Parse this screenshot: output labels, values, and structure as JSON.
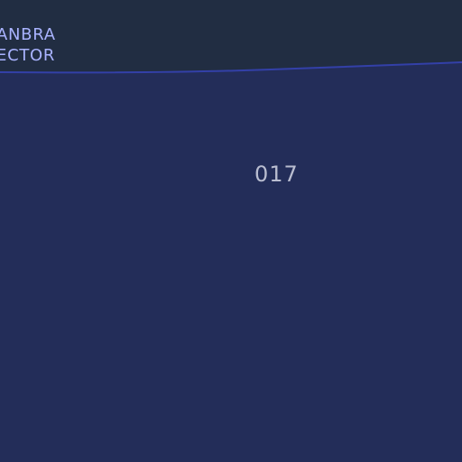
{
  "map": {
    "colors": {
      "background": "#212d42",
      "region_fill": "#232d59",
      "boundary": "#3340a8",
      "sector_text": "#a9b3ff",
      "zone_text": "#b9bdd0"
    },
    "sector_label": {
      "line1": "ANBRA",
      "line2": "ECTOR"
    },
    "zone_label": "017"
  }
}
